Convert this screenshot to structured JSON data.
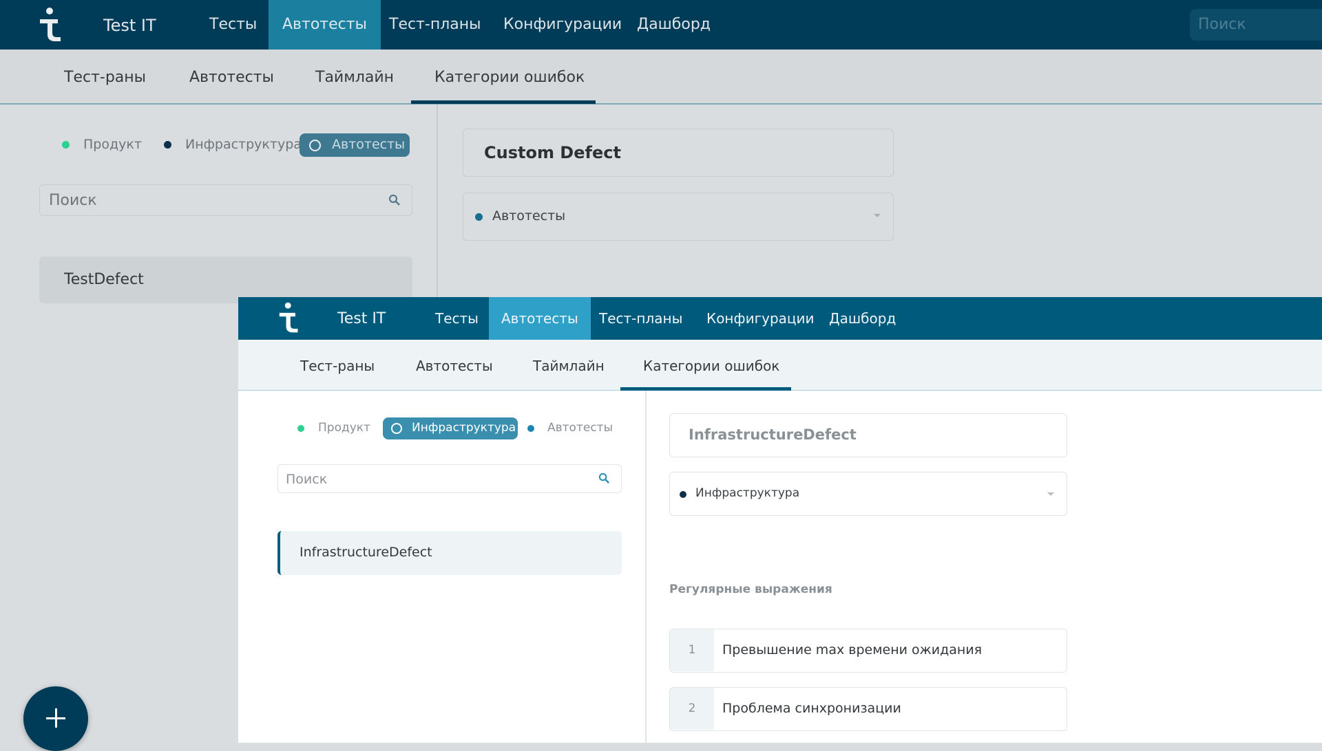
{
  "app": {
    "title": "Test IT"
  },
  "nav": [
    "Тесты",
    "Автотесты",
    "Тест-планы",
    "Конфигурации",
    "Дашборд"
  ],
  "subtabs": [
    "Тест-раны",
    "Автотесты",
    "Таймлайн",
    "Категории ошибок"
  ],
  "filters": [
    "Продукт",
    "Инфраструктура",
    "Автотесты"
  ],
  "search_placeholder": "Поиск",
  "back_window": {
    "active_nav": "Автотесты",
    "active_filter": "Автотесты",
    "list_item": "TestDefect",
    "defect_name": "Custom Defect",
    "category": "Автотесты"
  },
  "front_window": {
    "active_nav": "Автотесты",
    "active_filter": "Инфраструктура",
    "list_item": "InfrastructureDefect",
    "defect_name": "InfrastructureDefect",
    "category": "Инфраструктура",
    "regex_heading": "Регулярные выражения",
    "regex": [
      {
        "num": "1",
        "text": "Превышение max времени ожидания"
      },
      {
        "num": "2",
        "text": "Проблема синхронизации"
      }
    ]
  },
  "colors": {
    "product": "#2fcf92",
    "infrastructure": "#0c2f4a",
    "autotests": "#1a85b0",
    "primary_dark": "#003c57",
    "primary": "#005a7c",
    "accent": "#2fa0c8"
  }
}
